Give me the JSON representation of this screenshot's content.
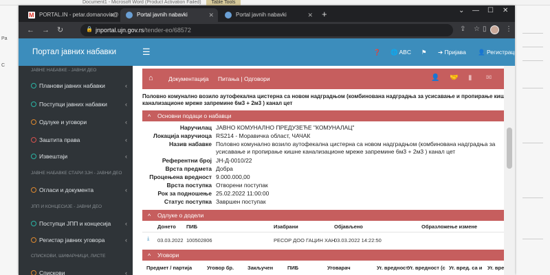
{
  "word": {
    "title": "Document1 - Microsoft Word (Product Activation Failed)",
    "table_tools": "Table Tools",
    "left_labels": [
      "Pa",
      "C"
    ]
  },
  "browser": {
    "tabs": [
      {
        "title": "PORTAL.IN - petar.domanovic@..."
      },
      {
        "title": "Portal javnih nabavki"
      },
      {
        "title": "Portal javnih nabavki"
      }
    ],
    "new_tab": "+",
    "url_host": "jnportal.ujn.gov.rs",
    "url_path": "/tender-eo/68572"
  },
  "brand": "Портал јавних набавки",
  "topnav": {
    "lang": "ABC",
    "login": "Пријава",
    "register": "Регистрација"
  },
  "sidebar": {
    "headers": [
      "ЈАВНЕ НАБАВКЕ - ЈАВНИ ДЕО",
      "ЈАВНЕ НАБАВКЕ СТАРИ ЗЈН - ЈАВНИ ДЕО",
      "ЈПП И КОНЦЕСИЈЕ - ЈАВНИ ДЕО",
      "СПИСКОВИ, ШИФАРНИЦИ, ЛИСТЕ"
    ],
    "items": [
      {
        "label": "Планови јавних набавки",
        "color": "#2bb5a5"
      },
      {
        "label": "Поступци јавних набавки",
        "color": "#2bb5a5"
      },
      {
        "label": "Одлуке и уговори",
        "color": "#e08a2f"
      },
      {
        "label": "Заштита права",
        "color": "#d9534f"
      },
      {
        "label": "Извештаји",
        "color": "#2bb5a5"
      },
      {
        "label": "Огласи и документа",
        "color": "#e08a2f"
      },
      {
        "label": "Поступци ЈПП и концесија",
        "color": "#2bb5a5"
      },
      {
        "label": "Регистар јавних уговора",
        "color": "#e08a2f"
      },
      {
        "label": "Спискови",
        "color": "#e08a2f"
      }
    ]
  },
  "tender": {
    "links": [
      "Документација",
      "Питања | Одговори"
    ],
    "title": "Половно комунално возило аутофекална цистерна са новом надградњом (комбинована надградња за усисавање и пропирање кишне канализационе мреже запремине 6м3 + 2м3 ) канал цет",
    "sections": {
      "basic": "Основни подаци о набавци",
      "awards": "Одлуке о додели",
      "contracts": "Уговори"
    },
    "fields": [
      {
        "label": "Наручилац",
        "value": "ЈАВНО КОМУНАЛНО ПРЕДУЗЕЋЕ \"КОМУНАЛАЦ\""
      },
      {
        "label": "Локација наручиоца",
        "value": "RS214 - Моравичка област, ЧАЧАК"
      },
      {
        "label": "Назив набавке",
        "value": "Половно комунално возило аутофекална цистерна са новом надградњом (комбинована надградња за усисавање и пропирање кишне канализационе мреже запремине 6м3 + 2м3 ) канал цет"
      },
      {
        "label": "Референтни број",
        "value": "ЈН-Д-0010/22"
      },
      {
        "label": "Врста предмета",
        "value": "Добра"
      },
      {
        "label": "Процењена вредност",
        "value": "9.000.000,00"
      },
      {
        "label": "Врста поступка",
        "value": "Отворени поступак"
      },
      {
        "label": "Рок за подношење",
        "value": "25.02.2022 11:00:00"
      },
      {
        "label": "Статус поступка",
        "value": "Завршен поступак"
      }
    ],
    "awards_headers": [
      "Донето",
      "ПИБ",
      "Изабрани",
      "Објављено",
      "Образложење измене"
    ],
    "awards_row": [
      "03.03.2022",
      "100502806",
      "РЕСОР ДОО ГАЦИН ХАН",
      "03.03.2022 14:22:50"
    ],
    "more": "•••",
    "contracts_headers": [
      "Предмет / партија",
      "Уговор бр.",
      "Закључен",
      "ПИБ",
      "Уговарач",
      "Уг. вредност",
      "Уг. вредност (с",
      "Уг. вред. са и",
      "Уг. вред. са и"
    ]
  },
  "colors": {
    "brand_blue": "#3c8dbc",
    "tender_red": "#c65e5e",
    "sidebar": "#2f3438"
  }
}
